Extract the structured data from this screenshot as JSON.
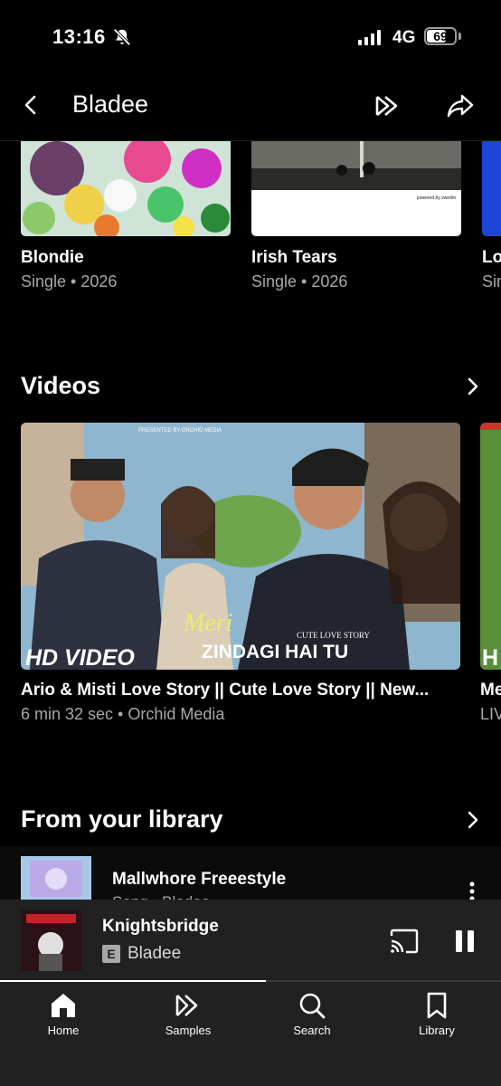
{
  "status_bar": {
    "time": "13:16",
    "network": "4G",
    "battery": "69",
    "battery_level": 0.69
  },
  "header": {
    "title": "Bladee"
  },
  "singles": [
    {
      "title": "Blondie",
      "subtitle": "Single • 2026"
    },
    {
      "title": "Irish Tears",
      "subtitle": "Single • 2026",
      "thumb_text": "powered by swedm"
    },
    {
      "title": "Lo",
      "subtitle": "Sin"
    }
  ],
  "videos_section": {
    "title": "Videos"
  },
  "videos": [
    {
      "title": "Ario & Misti Love Story  || Cute Love Story || New...",
      "meta": "6 min 32 sec • Orchid Media",
      "thumb_presenter": "PRESENTED BY-ORCHID MEDIA",
      "thumb_badge": "HD VIDEO",
      "thumb_script": "Meri",
      "thumb_tagline": "CUTE LOVE STORY",
      "thumb_caption": "ZINDAGI HAI TU"
    },
    {
      "title": "Me",
      "meta": "LIV",
      "thumb_badge": "H"
    }
  ],
  "library_section": {
    "title": "From your library"
  },
  "library_items": [
    {
      "title": "Mallwhore Freeestyle",
      "subtitle": "Song • Bladee"
    }
  ],
  "now_playing": {
    "title": "Knightsbridge",
    "artist": "Bladee",
    "explicit_badge": "E",
    "progress": 0.53
  },
  "nav": [
    {
      "label": "Home",
      "icon": "home-icon"
    },
    {
      "label": "Samples",
      "icon": "samples-icon"
    },
    {
      "label": "Search",
      "icon": "search-icon"
    },
    {
      "label": "Library",
      "icon": "library-icon"
    }
  ]
}
